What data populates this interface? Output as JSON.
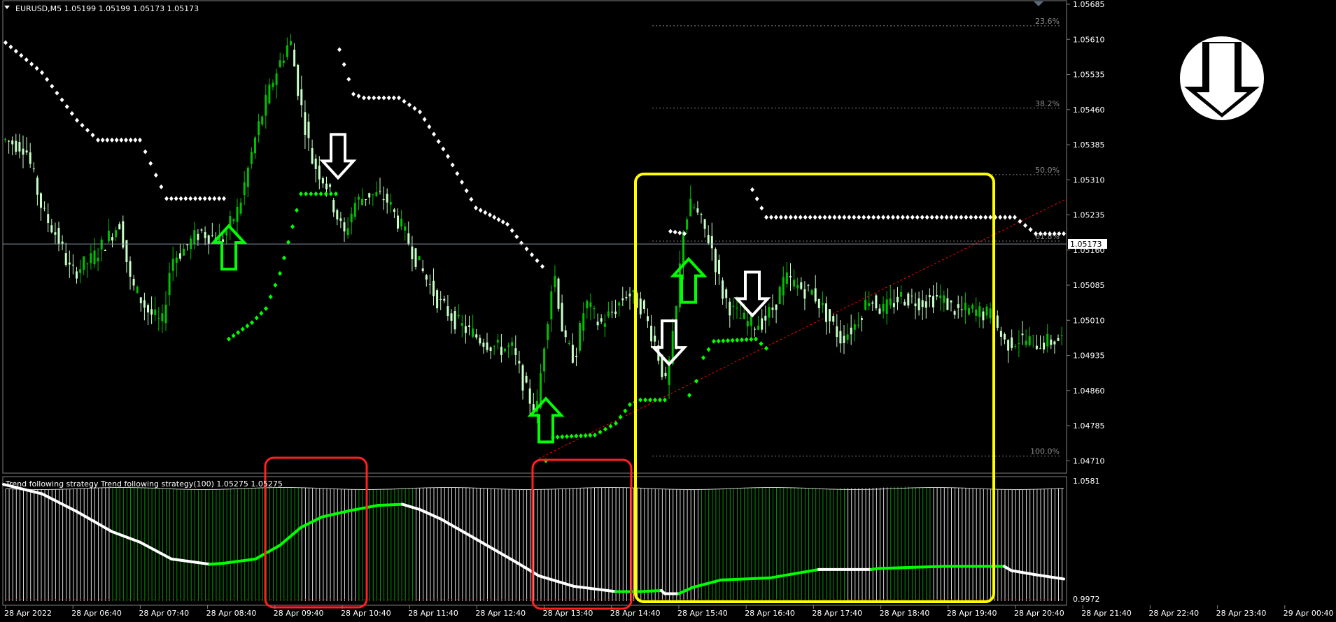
{
  "header": {
    "symbol_info": "EURUSD,M5  1.05199 1.05199 1.05173 1.05173",
    "indicator_info": "Trend following strategy  Trend following strategy(100) 1.05275 1.05275"
  },
  "colors": {
    "background": "#000000",
    "candle_bull": "#00c000",
    "candle_bear": "#c8ffc8",
    "stop_up": "#00ff00",
    "stop_down": "#ffffff",
    "highlight_box": "#ffff00",
    "signal_box": "#ff2020",
    "hist_green": "#00a000",
    "hist_white": "#ffffff",
    "trend_up": "#00ff00",
    "trend_down": "#ffffff",
    "fib": "#7f7f7f",
    "trendline": "#ff0000",
    "grid_axis": "#7f7f7f",
    "bid_line": "#7f8f9f"
  },
  "icons": {
    "signal_logo": "white-down-arrow-circle-icon",
    "up_signal": "green-up-arrow-icon",
    "down_signal": "white-down-arrow-icon"
  },
  "chart_data": {
    "type": "candlestick",
    "symbol": "EURUSD",
    "timeframe": "M5",
    "ohlc": {
      "open": 1.05199,
      "high": 1.05199,
      "low": 1.05173,
      "close": 1.05173
    },
    "price_axis": [
      "1.05685",
      "1.05610",
      "1.05535",
      "1.05460",
      "1.05385",
      "1.05310",
      "1.05235",
      "1.05160",
      "1.05085",
      "1.05010",
      "1.04935",
      "1.04860",
      "1.04785",
      "1.04710"
    ],
    "current_price": "1.05173",
    "ylim": [
      1.0469,
      1.05685
    ],
    "time_axis": [
      "28 Apr 2022",
      "28 Apr 06:40",
      "28 Apr 07:40",
      "28 Apr 08:40",
      "28 Apr 09:40",
      "28 Apr 10:40",
      "28 Apr 11:40",
      "28 Apr 12:40",
      "28 Apr 13:40",
      "28 Apr 14:40",
      "28 Apr 15:40",
      "28 Apr 16:40",
      "28 Apr 17:40",
      "28 Apr 18:40",
      "28 Apr 19:40",
      "28 Apr 20:40",
      "28 Apr 21:40",
      "28 Apr 22:40",
      "28 Apr 23:40",
      "29 Apr 00:40"
    ],
    "price_path": [
      [
        0,
        1.054
      ],
      [
        40,
        1.0538
      ],
      [
        65,
        1.0524
      ],
      [
        85,
        1.0519
      ],
      [
        105,
        1.0511
      ],
      [
        135,
        1.0514
      ],
      [
        155,
        1.0518
      ],
      [
        175,
        1.0522
      ],
      [
        190,
        1.0509
      ],
      [
        215,
        1.0503
      ],
      [
        235,
        1.05
      ],
      [
        248,
        1.0514
      ],
      [
        265,
        1.0516
      ],
      [
        290,
        1.052
      ],
      [
        320,
        1.0518
      ],
      [
        345,
        1.0525
      ],
      [
        370,
        1.0541
      ],
      [
        395,
        1.0553
      ],
      [
        418,
        1.0561
      ],
      [
        432,
        1.0548
      ],
      [
        450,
        1.0535
      ],
      [
        470,
        1.053
      ],
      [
        495,
        1.0519
      ],
      [
        510,
        1.0526
      ],
      [
        530,
        1.0528
      ],
      [
        555,
        1.0527
      ],
      [
        580,
        1.052
      ],
      [
        605,
        1.0512
      ],
      [
        630,
        1.0505
      ],
      [
        660,
        1.05
      ],
      [
        690,
        1.0497
      ],
      [
        715,
        1.0495
      ],
      [
        735,
        1.0495
      ],
      [
        755,
        1.0486
      ],
      [
        770,
        1.0481
      ],
      [
        780,
        1.0495
      ],
      [
        795,
        1.0512
      ],
      [
        810,
        1.0496
      ],
      [
        825,
        1.0493
      ],
      [
        840,
        1.0505
      ],
      [
        860,
        1.05
      ],
      [
        880,
        1.0503
      ],
      [
        900,
        1.0507
      ],
      [
        920,
        1.0504
      ],
      [
        940,
        1.0496
      ],
      [
        955,
        1.0487
      ],
      [
        968,
        1.05
      ],
      [
        980,
        1.0521
      ],
      [
        992,
        1.0526
      ],
      [
        1005,
        1.0522
      ],
      [
        1020,
        1.0517
      ],
      [
        1035,
        1.0507
      ],
      [
        1050,
        1.0503
      ],
      [
        1065,
        1.0501
      ],
      [
        1080,
        1.05
      ],
      [
        1095,
        1.0501
      ],
      [
        1110,
        1.0504
      ],
      [
        1125,
        1.051
      ],
      [
        1145,
        1.0508
      ],
      [
        1165,
        1.0507
      ],
      [
        1185,
        1.0502
      ],
      [
        1205,
        1.0497
      ],
      [
        1225,
        1.05
      ],
      [
        1245,
        1.0506
      ],
      [
        1265,
        1.0503
      ],
      [
        1290,
        1.0506
      ],
      [
        1320,
        1.0505
      ],
      [
        1345,
        1.0506
      ],
      [
        1370,
        1.0503
      ],
      [
        1395,
        1.0503
      ],
      [
        1420,
        1.0502
      ],
      [
        1440,
        1.0496
      ],
      [
        1460,
        1.0497
      ],
      [
        1490,
        1.0496
      ],
      [
        1520,
        1.0497
      ]
    ],
    "stop_line_down_segments": [
      [
        [
          8,
          1.05603
        ],
        [
          60,
          1.05539
        ],
        [
          110,
          1.05437
        ],
        [
          140,
          1.05395
        ],
        [
          200,
          1.05395
        ],
        [
          238,
          1.0527
        ],
        [
          320,
          1.0527
        ]
      ],
      [
        [
          485,
          1.05588
        ],
        [
          505,
          1.05493
        ],
        [
          520,
          1.05485
        ],
        [
          570,
          1.05485
        ],
        [
          600,
          1.05455
        ],
        [
          640,
          1.0536
        ],
        [
          680,
          1.0525
        ],
        [
          700,
          1.05235
        ],
        [
          725,
          1.05215
        ],
        [
          745,
          1.05175
        ],
        [
          775,
          1.05125
        ]
      ],
      [
        [
          958,
          1.052
        ],
        [
          978,
          1.05195
        ]
      ],
      [
        [
          1075,
          1.05289
        ],
        [
          1095,
          1.0523
        ],
        [
          1450,
          1.0523
        ],
        [
          1480,
          1.05195
        ],
        [
          1520,
          1.05195
        ]
      ]
    ],
    "stop_line_up_segments": [
      [
        [
          327,
          1.0497
        ],
        [
          360,
          1.05005
        ],
        [
          380,
          1.05035
        ],
        [
          400,
          1.0511
        ],
        [
          418,
          1.0521
        ],
        [
          430,
          1.0528
        ],
        [
          480,
          1.0528
        ]
      ],
      [
        [
          780,
          1.0471
        ],
        [
          790,
          1.0476
        ],
        [
          850,
          1.04765
        ],
        [
          880,
          1.0479
        ],
        [
          900,
          1.0483
        ],
        [
          915,
          1.0484
        ],
        [
          950,
          1.0484
        ]
      ],
      [
        [
          985,
          1.0485
        ],
        [
          995,
          1.0488
        ],
        [
          1005,
          1.0493
        ],
        [
          1020,
          1.04965
        ],
        [
          1080,
          1.0497
        ],
        [
          1095,
          1.0495
        ]
      ]
    ],
    "fibonacci": {
      "levels": [
        {
          "label": "23.6%",
          "price": 1.05639
        },
        {
          "label": "38.2%",
          "price": 1.05463
        },
        {
          "label": "50.0%",
          "price": 1.05321
        },
        {
          "label": "61.8%",
          "price": 1.05179
        },
        {
          "label": "100.0%",
          "price": 1.0472
        }
      ]
    },
    "trendline": [
      [
        770,
        1.04715
      ],
      [
        1525,
        1.0527
      ]
    ],
    "signals": [
      {
        "type": "up",
        "x": 327,
        "price": 1.05167
      },
      {
        "type": "down",
        "x": 483,
        "price": 1.05359
      },
      {
        "type": "up",
        "x": 780,
        "price": 1.04798
      },
      {
        "type": "down",
        "x": 956,
        "price": 1.04961
      },
      {
        "type": "up",
        "x": 984,
        "price": 1.05096
      },
      {
        "type": "down",
        "x": 1075,
        "price": 1.05065
      }
    ],
    "indicator": {
      "name": "Trend following strategy",
      "period": 100,
      "value": 1.05275,
      "ylim": [
        0.9972,
        1.0581
      ],
      "axis_labels": [
        "1.0581",
        "0.9972"
      ],
      "trend_line": [
        [
          5,
          1.0571,
          "down"
        ],
        [
          60,
          1.0562,
          "down"
        ],
        [
          110,
          1.0545,
          "down"
        ],
        [
          160,
          1.0526,
          "down"
        ],
        [
          200,
          1.0516,
          "down"
        ],
        [
          245,
          1.05,
          "down"
        ],
        [
          300,
          1.0495,
          "down"
        ],
        [
          320,
          1.0496,
          "up"
        ],
        [
          365,
          1.05,
          "up"
        ],
        [
          400,
          1.0513,
          "up"
        ],
        [
          430,
          1.053,
          "up"
        ],
        [
          460,
          1.054,
          "up"
        ],
        [
          500,
          1.0546,
          "up"
        ],
        [
          540,
          1.0551,
          "up"
        ],
        [
          575,
          1.0552,
          "up"
        ],
        [
          600,
          1.0547,
          "down"
        ],
        [
          630,
          1.0538,
          "down"
        ],
        [
          680,
          1.0519,
          "down"
        ],
        [
          740,
          1.0496,
          "down"
        ],
        [
          770,
          1.0484,
          "down"
        ],
        [
          820,
          1.0474,
          "down"
        ],
        [
          880,
          1.0469,
          "down"
        ],
        [
          915,
          1.0469,
          "up"
        ],
        [
          945,
          1.047,
          "up"
        ],
        [
          950,
          1.0467,
          "down"
        ],
        [
          970,
          1.0467,
          "down"
        ],
        [
          990,
          1.0473,
          "up"
        ],
        [
          1030,
          1.048,
          "up"
        ],
        [
          1100,
          1.0482,
          "up"
        ],
        [
          1170,
          1.049,
          "up"
        ],
        [
          1215,
          1.049,
          "down"
        ],
        [
          1245,
          1.049,
          "down"
        ],
        [
          1255,
          1.0491,
          "up"
        ],
        [
          1350,
          1.0493,
          "up"
        ],
        [
          1435,
          1.0493,
          "up"
        ],
        [
          1445,
          1.0489,
          "down"
        ],
        [
          1480,
          1.0485,
          "down"
        ],
        [
          1520,
          1.0481,
          "down"
        ]
      ],
      "green_bar_ranges": [
        [
          160,
          430
        ],
        [
          510,
          590
        ],
        [
          1000,
          1210
        ],
        [
          1270,
          1330
        ]
      ]
    },
    "boxes": [
      {
        "name": "yellow-highlight-box",
        "color": "yellow"
      },
      {
        "name": "red-signal-box-1",
        "color": "red"
      },
      {
        "name": "red-signal-box-2",
        "color": "red"
      }
    ]
  }
}
